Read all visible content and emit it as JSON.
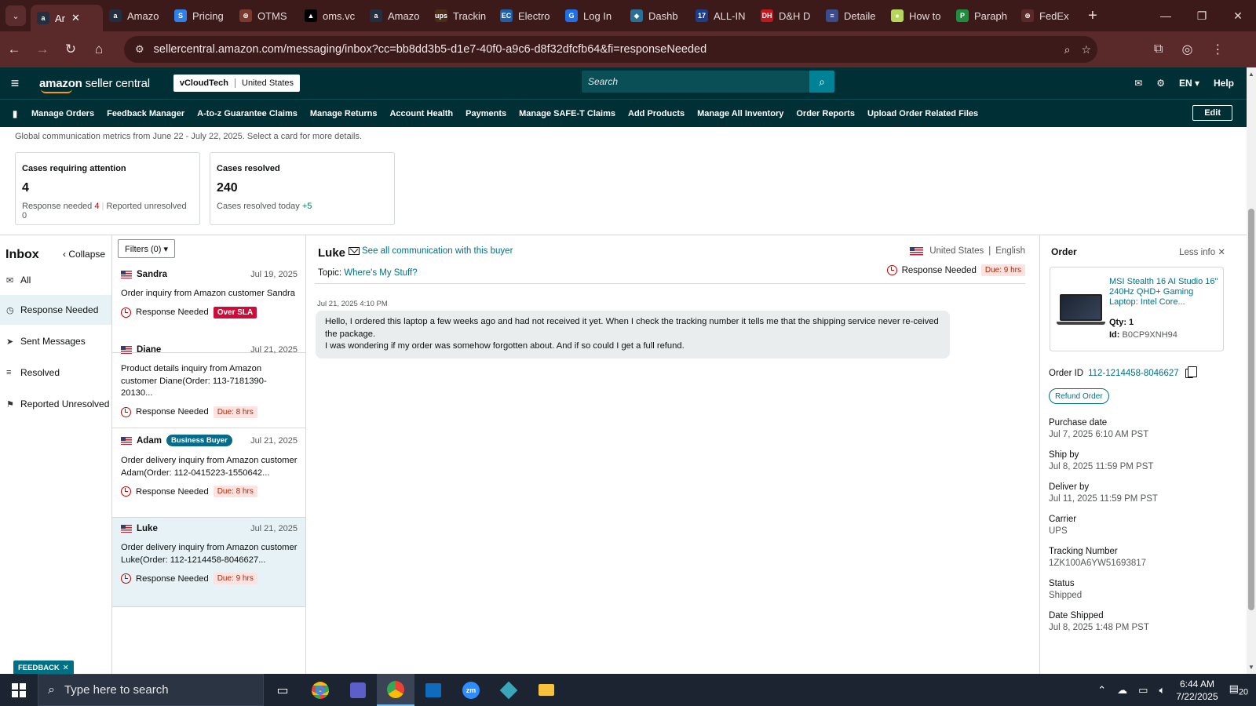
{
  "browser": {
    "tabs": [
      {
        "label": "Ar",
        "fav": "a",
        "color": "#232f3e",
        "active": true
      },
      {
        "label": "Amazo",
        "fav": "a",
        "color": "#232f3e"
      },
      {
        "label": "Pricing",
        "fav": "S",
        "color": "#2f80ed"
      },
      {
        "label": "OTMS",
        "fav": "⊛",
        "color": "#7a3b2e"
      },
      {
        "label": "oms.vc",
        "fav": "▲",
        "color": "#000000"
      },
      {
        "label": "Amazo",
        "fav": "a",
        "color": "#232f3e"
      },
      {
        "label": "Trackin",
        "fav": "ups",
        "color": "#4b2e1a"
      },
      {
        "label": "Electro",
        "fav": "EC",
        "color": "#1e5fa8"
      },
      {
        "label": "Log In",
        "fav": "G",
        "color": "#1f6feb"
      },
      {
        "label": "Dashb",
        "fav": "◆",
        "color": "#2a6f97"
      },
      {
        "label": "ALL-IN",
        "fav": "17",
        "color": "#1d3e8a"
      },
      {
        "label": "D&H D",
        "fav": "DH",
        "color": "#c4161c"
      },
      {
        "label": "Detaile",
        "fav": "≡",
        "color": "#3b4c8a"
      },
      {
        "label": "How to",
        "fav": "●",
        "color": "#b6d65a"
      },
      {
        "label": "Paraph",
        "fav": "P",
        "color": "#1e8e3e"
      },
      {
        "label": "FedEx",
        "fav": "⊛",
        "color": "#5a2a2a"
      }
    ],
    "url": "sellercentral.amazon.com/messaging/inbox?cc=bb8dd3b5-d1e7-40f0-a9c6-d8f32dfcfb64&fi=responseNeeded"
  },
  "header": {
    "logo_main": "amazon",
    "logo_sub": " seller central",
    "account_name": "vCloudTech",
    "account_region": "United States",
    "search_placeholder": "Search",
    "language": "EN ▾",
    "help": "Help"
  },
  "nav": {
    "items": [
      "Manage Orders",
      "Feedback Manager",
      "A-to-z Guarantee Claims",
      "Manage Returns",
      "Account Health",
      "Payments",
      "Manage SAFE-T Claims",
      "Add Products",
      "Manage All Inventory",
      "Order Reports",
      "Upload Order Related Files"
    ],
    "edit": "Edit"
  },
  "metrics": {
    "description": "Global communication metrics from June 22 - July 22, 2025. Select a card for more details.",
    "attention": {
      "title": "Cases requiring attention",
      "value": "4",
      "rn_label": "Response needed",
      "rn_value": "4",
      "ru_label": "Reported unresolved",
      "ru_value": "0"
    },
    "resolved": {
      "title": "Cases resolved",
      "value": "240",
      "today_label": "Cases resolved today",
      "today_value": "+5"
    }
  },
  "sidebar": {
    "title": "Inbox",
    "collapse": "Collapse",
    "items": [
      {
        "label": "All",
        "icon": "mail-icon"
      },
      {
        "label": "Response Needed",
        "icon": "clock-icon"
      },
      {
        "label": "Sent Messages",
        "icon": "send-icon"
      },
      {
        "label": "Resolved",
        "icon": "check-list-icon"
      },
      {
        "label": "Reported Unresolved",
        "icon": "report-user-icon"
      }
    ]
  },
  "list": {
    "filters": "Filters (0) ▾",
    "conversations": [
      {
        "name": "Sandra",
        "date": "Jul 19, 2025",
        "preview": "Order inquiry from Amazon customer Sandra",
        "status": "Response Needed",
        "badge": "Over SLA",
        "tag": ""
      },
      {
        "name": "Diane",
        "date": "Jul 21, 2025",
        "preview": "Product details inquiry from Amazon customer Diane(Order: 113-7181390-20130...",
        "status": "Response Needed",
        "badge": "Due: 8 hrs",
        "tag": ""
      },
      {
        "name": "Adam",
        "date": "Jul 21, 2025",
        "preview": "Order delivery inquiry from Amazon customer Adam(Order: 112-0415223-1550642...",
        "status": "Response Needed",
        "badge": "Due: 8 hrs",
        "tag": "Business Buyer"
      },
      {
        "name": "Luke",
        "date": "Jul 21, 2025",
        "preview": "Order delivery inquiry from Amazon customer Luke(Order: 112-1214458-8046627...",
        "status": "Response Needed",
        "badge": "Due: 9 hrs",
        "tag": ""
      }
    ]
  },
  "conversation": {
    "buyer": "Luke",
    "see_all": "See all communication with this buyer",
    "topic_label": "Topic:",
    "topic": "Where's My Stuff?",
    "country": "United States",
    "language": "English",
    "status": "Response Needed",
    "due": "Due: 9 hrs",
    "message_time": "Jul 21, 2025 4:10 PM",
    "message_line1": "Hello, I ordered this laptop a few weeks ago and had not received it yet. When I check the tracking number it tells me that the shipping service never re-ceived the package.",
    "message_line2": "I was wondering if my order was somehow forgotten about. And if so could I get a full refund."
  },
  "order": {
    "title": "Order",
    "less_info": "Less info",
    "product_name": "MSI Stealth 16 AI Studio 16\" 240Hz QHD+ Gaming Laptop: Intel Core...",
    "qty": "Qty: 1",
    "id_label": "Id:",
    "id": "B0CP9XNH94",
    "order_id_label": "Order ID",
    "order_id": "112-1214458-8046627",
    "refund": "Refund Order",
    "fields": [
      {
        "label": "Purchase date",
        "value": "Jul 7, 2025 6:10 AM PST"
      },
      {
        "label": "Ship by",
        "value": "Jul 8, 2025 11:59 PM PST"
      },
      {
        "label": "Deliver by",
        "value": "Jul 11, 2025 11:59 PM PST"
      },
      {
        "label": "Carrier",
        "value": "UPS"
      },
      {
        "label": "Tracking Number",
        "value": "1ZK100A6YW51693817"
      },
      {
        "label": "Status",
        "value": "Shipped"
      },
      {
        "label": "Date Shipped",
        "value": "Jul 8, 2025 1:48 PM PST"
      }
    ]
  },
  "feedback": "FEEDBACK",
  "taskbar": {
    "search_placeholder": "Type here to search",
    "time": "6:44 AM",
    "date": "7/22/2025",
    "notifications": "20"
  }
}
